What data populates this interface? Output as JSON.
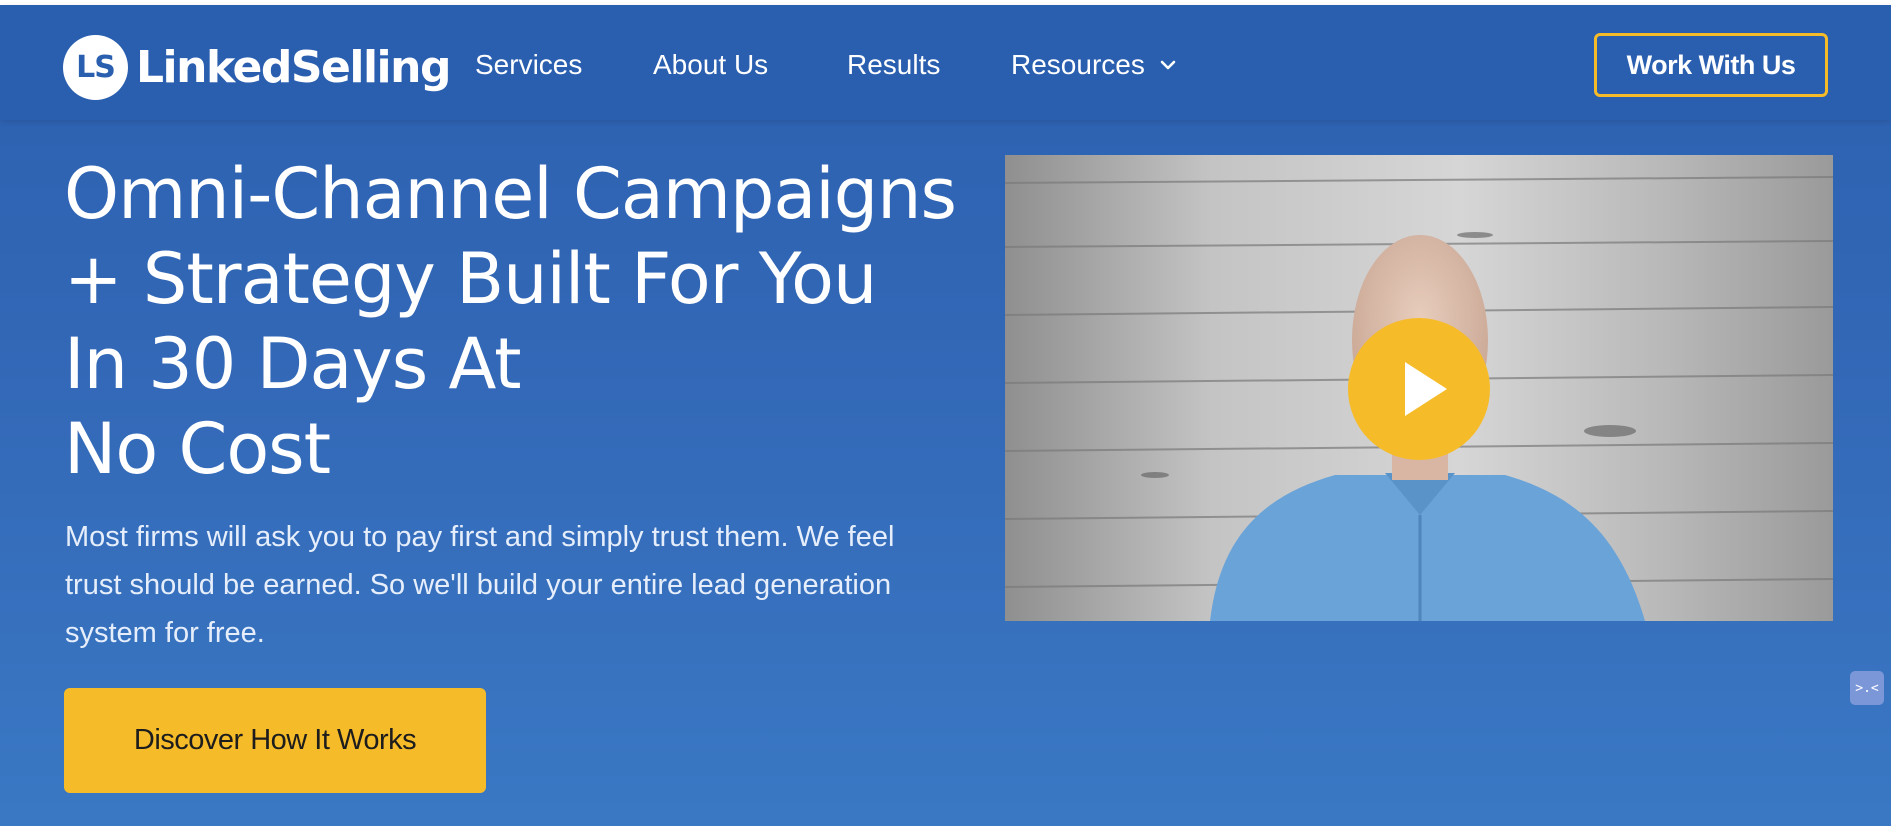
{
  "brand": {
    "logo_mark": "LS",
    "name": "LinkedSelling"
  },
  "nav": {
    "items": [
      {
        "label": "Services"
      },
      {
        "label": "About Us"
      },
      {
        "label": "Results"
      },
      {
        "label": "Resources"
      }
    ],
    "cta_label": "Work With Us"
  },
  "hero": {
    "headline_lines": [
      "Omni-Channel Campaigns",
      "+ Strategy Built For You",
      "In 30 Days At",
      "No Cost"
    ],
    "subtext": "Most firms will ask you to pay first and simply trust them. We feel trust should be earned. So we'll build your entire lead generation system for free.",
    "cta_label": "Discover How It Works"
  },
  "video": {
    "play_icon": "play-icon"
  },
  "helper_widget": {
    "icon_text": ">.<"
  },
  "colors": {
    "brand_blue": "#2a5eaf",
    "accent_yellow": "#f6bb29",
    "shirt_blue": "#6aa3d8"
  }
}
